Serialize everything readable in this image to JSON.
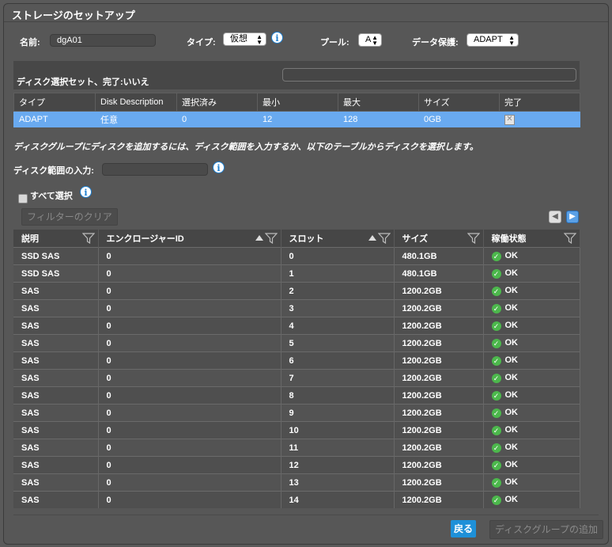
{
  "dialog": {
    "title": "ストレージのセットアップ"
  },
  "form": {
    "name_label": "名前:",
    "name_value": "dgA01",
    "type_label": "タイプ:",
    "type_value": "仮想",
    "pool_label": "プール:",
    "pool_value": "A",
    "protection_label": "データ保護:",
    "protection_value": "ADAPT"
  },
  "disk_set": {
    "status_label": "ディスク選択セット、完了:いいえ",
    "search_value": "",
    "columns": [
      "タイプ",
      "Disk Description",
      "選択済み",
      "最小",
      "最大",
      "サイズ",
      "完了"
    ],
    "row": {
      "type": "ADAPT",
      "description": "任意",
      "selected": "0",
      "min": "12",
      "max": "128",
      "size": "0GB"
    }
  },
  "instructions": "ディスクグループにディスクを追加するには、ディスク範囲を入力するか、以下のテーブルからディスクを選択します。",
  "range": {
    "label": "ディスク範囲の入力:",
    "value": ""
  },
  "select_all": {
    "label": "すべて選択"
  },
  "filter_clear_label": "フィルターのクリア",
  "disks": {
    "columns": [
      "説明",
      "エンクロージャーID",
      "スロット",
      "サイズ",
      "稼働状態"
    ],
    "rows": [
      [
        "SSD SAS",
        "0",
        "0",
        "480.1GB",
        "OK"
      ],
      [
        "SSD SAS",
        "0",
        "1",
        "480.1GB",
        "OK"
      ],
      [
        "SAS",
        "0",
        "2",
        "1200.2GB",
        "OK"
      ],
      [
        "SAS",
        "0",
        "3",
        "1200.2GB",
        "OK"
      ],
      [
        "SAS",
        "0",
        "4",
        "1200.2GB",
        "OK"
      ],
      [
        "SAS",
        "0",
        "5",
        "1200.2GB",
        "OK"
      ],
      [
        "SAS",
        "0",
        "6",
        "1200.2GB",
        "OK"
      ],
      [
        "SAS",
        "0",
        "7",
        "1200.2GB",
        "OK"
      ],
      [
        "SAS",
        "0",
        "8",
        "1200.2GB",
        "OK"
      ],
      [
        "SAS",
        "0",
        "9",
        "1200.2GB",
        "OK"
      ],
      [
        "SAS",
        "0",
        "10",
        "1200.2GB",
        "OK"
      ],
      [
        "SAS",
        "0",
        "11",
        "1200.2GB",
        "OK"
      ],
      [
        "SAS",
        "0",
        "12",
        "1200.2GB",
        "OK"
      ],
      [
        "SAS",
        "0",
        "13",
        "1200.2GB",
        "OK"
      ],
      [
        "SAS",
        "0",
        "14",
        "1200.2GB",
        "OK"
      ]
    ]
  },
  "buttons": {
    "back": "戻る",
    "add_group": "ディスクグループの追加"
  },
  "colors": {
    "accent": "#1e90d8",
    "selected_row": "#69aaf0",
    "ok": "#4cb84c"
  }
}
